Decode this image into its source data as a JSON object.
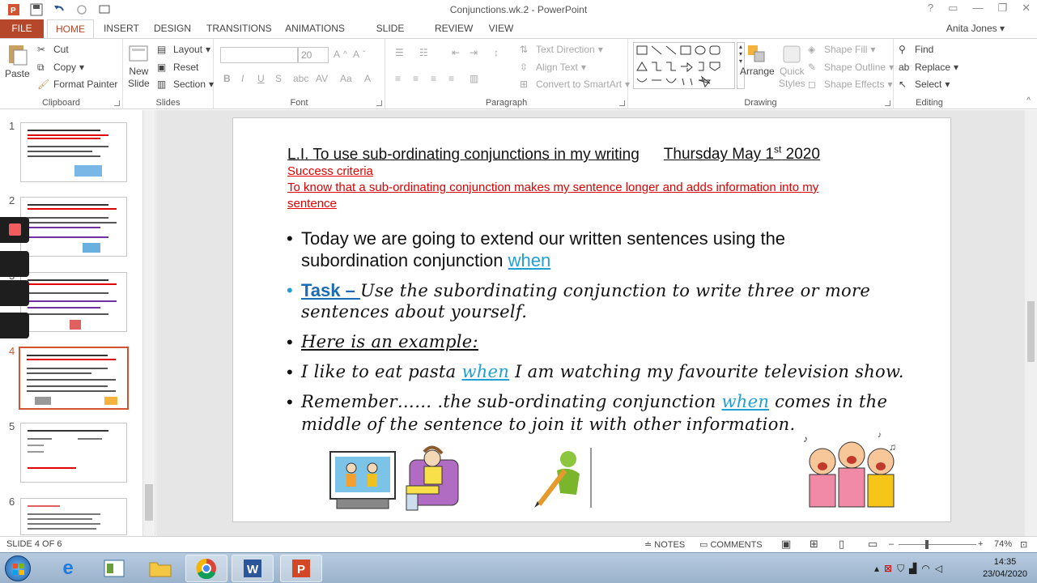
{
  "window": {
    "title": "Conjunctions.wk.2 - PowerPoint",
    "controls": [
      "?",
      "▭",
      "—",
      "❐",
      "✕"
    ]
  },
  "tabs": [
    "FILE",
    "HOME",
    "INSERT",
    "DESIGN",
    "TRANSITIONS",
    "ANIMATIONS",
    "SLIDE SHOW",
    "REVIEW",
    "VIEW"
  ],
  "user": "Anita Jones",
  "ribbon": {
    "clipboard": {
      "label": "Clipboard",
      "paste": "Paste",
      "cut": "Cut",
      "copy": "Copy",
      "format_painter": "Format Painter"
    },
    "slides": {
      "label": "Slides",
      "new_slide": "New",
      "new_slide2": "Slide",
      "layout": "Layout",
      "reset": "Reset",
      "section": "Section"
    },
    "font": {
      "label": "Font",
      "font_name": "",
      "font_size": "20"
    },
    "paragraph": {
      "label": "Paragraph",
      "text_direction": "Text Direction",
      "align_text": "Align Text",
      "convert_smartart": "Convert to SmartArt"
    },
    "drawing": {
      "label": "Drawing",
      "arrange": "Arrange",
      "quick_styles": "Quick",
      "quick_styles2": "Styles",
      "shape_fill": "Shape Fill",
      "shape_outline": "Shape Outline",
      "shape_effects": "Shape Effects"
    },
    "editing": {
      "label": "Editing",
      "find": "Find",
      "replace": "Replace",
      "select": "Select"
    }
  },
  "thumbnails": [
    "1",
    "2",
    "3",
    "4",
    "5",
    "6"
  ],
  "slide": {
    "title": "L.I. To use sub-ordinating conjunctions in my writing",
    "date_prefix": "Thursday May 1",
    "date_sup": "st",
    "date_year": " 2020",
    "criteria_heading": "Success criteria",
    "criteria_line1": "To know that a sub-ordinating conjunction makes my sentence longer and adds information into my",
    "criteria_line2": "sentence",
    "b1_line1": "Today we are going to extend our written sentences using the",
    "b1_line2_pre": "subordination conjunction ",
    "b1_kw": "when",
    "b2_task": "Task – ",
    "b2_line1": "Use the subordinating conjunction to write three or more",
    "b2_line2": "sentences about yourself.",
    "b3": "Here is an example:",
    "b4_pre": "I like to eat pasta ",
    "b4_kw": "when",
    "b4_post": " I am watching my favourite television show.",
    "b5_pre": "Remember…… .the sub-ordinating conjunction ",
    "b5_kw": "when",
    "b5_post": " comes in the",
    "b5_line2": "middle of the sentence to join it with other information."
  },
  "status": {
    "slide_counter": "SLIDE 4 OF 6",
    "notes": "NOTES",
    "comments": "COMMENTS",
    "zoom": "74%"
  },
  "clock": {
    "time": "14:35",
    "date": "23/04/2020"
  }
}
